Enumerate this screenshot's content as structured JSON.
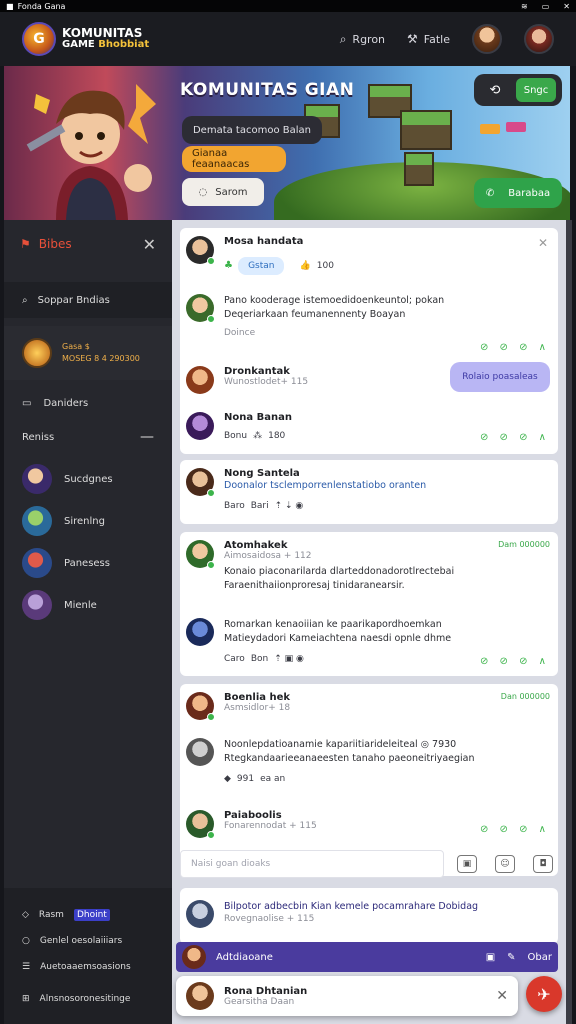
{
  "status": {
    "left": "Fonda Gana"
  },
  "header": {
    "logo_line1": "KOMUNITAS",
    "logo_line2": "GAME",
    "logo_line2b": "Bhobbiat",
    "link1": "Rgron",
    "link2": "Fatle"
  },
  "banner": {
    "title": "KOMUNITAS GIAN",
    "pill_dark": "Demata tacomoo Balan",
    "pill_orange": "Gianaa feaanaacas",
    "pill_light": "Sarom",
    "btn_green_top": "Sngc",
    "btn_green_bottom": "Barabaa"
  },
  "sidebar": {
    "head": "Bibes",
    "search": "Soppar Bndias",
    "promo_l1": "Gasa $",
    "promo_l2": "MOSEG 8 4 290300",
    "item_dens": "Daniders",
    "section": "Reniss",
    "games": [
      "Sucdgnes",
      "Sirenlng",
      "Panesess",
      "Mienle"
    ],
    "bottom": {
      "row1a": "Rasm",
      "row1b": "Dhoint",
      "row2": "Genlel oesolaiiiars",
      "row3": "Auetoaaemsoasions",
      "row4": "Alnsnosoronesitinge"
    }
  },
  "feed": {
    "c1": {
      "name": "Mosa handata",
      "pill": "Gstan",
      "score": "100",
      "line1": "Pano kooderage istemoedidoenkeuntol;  pokan",
      "line2": "Deqeriarkaan feumanennenty Boayan",
      "line3": "Doince",
      "name2": "Dronkantak",
      "sub2": "Wunostlodet+ 115",
      "bubble": "Rolaio poasaleas",
      "name3": "Nona Banan",
      "sub3": "Bonu",
      "score3": "180"
    },
    "c2": {
      "name": "Nong Santela",
      "line1": "Doonalor tsclemporrenlenstatiobo oranten",
      "tag1": "Baro",
      "tag2": "Bari"
    },
    "c3": {
      "name": "Atomhakek",
      "sub": "Aimosaidosa  +  112",
      "date": "Dam 000000",
      "line1": "Konaio piaconarilarda dlarteddonadorotlrectebai",
      "line2": "Faraenithaiionproresaj tinidaranearsir.",
      "line3": "Romarkan kenaoiiian ke paarikapordhoemkan",
      "line4": "Matieydadori Kameiachtena naesdi opnle dhme",
      "tag1": "Caro",
      "tag2": "Bon"
    },
    "c4": {
      "name": "Boenlia hek",
      "sub": "Asmsidlor+ 18",
      "date": "Dan 000000",
      "line1": "Noonlepdatioanamie kapariitiarideleiteal",
      "line1b": "7930",
      "line2": "Rtegkandaarieeanaeesten tanaho paeoneitriyaegian",
      "num": "991",
      "tag": "ea an",
      "name2": "Paiaboolis",
      "sub2": "Fonarennodat  + 115",
      "placeholder": "Naisi goan dioaks"
    },
    "c5": {
      "line1": "Bilpotor adbecbin Kian kemele pocamrahare Dobidag",
      "sub": "Rovegnaolise  + 115",
      "bar_label": "Adtdiaoane",
      "bar_right": "Obar"
    }
  },
  "toast": {
    "name": "Rona Dhtanian",
    "sub": "Gearsitha Daan"
  }
}
